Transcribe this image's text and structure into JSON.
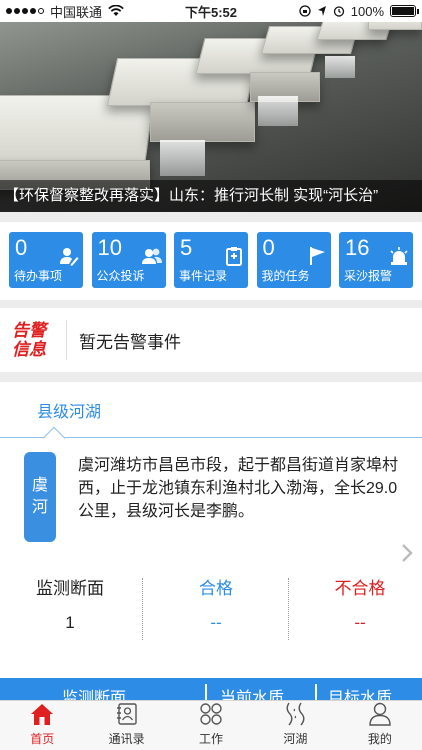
{
  "status_bar": {
    "carrier": "中国联通",
    "time": "下午5:52",
    "battery": "100%",
    "battery_level": 1.0
  },
  "banner": {
    "caption": "【环保督察整改再落实】山东：推行河长制 实现“河长治”"
  },
  "tiles": [
    {
      "count": "0",
      "label": "待办事项",
      "icon": "edit-person-icon"
    },
    {
      "count": "10",
      "label": "公众投诉",
      "icon": "group-icon"
    },
    {
      "count": "5",
      "label": "事件记录",
      "icon": "clipboard-icon"
    },
    {
      "count": "0",
      "label": "我的任务",
      "icon": "flag-icon"
    },
    {
      "count": "16",
      "label": "采沙报警",
      "icon": "alarm-light-icon"
    }
  ],
  "alert": {
    "tag_line1": "告警",
    "tag_line2": "信息",
    "message": "暂无告警事件"
  },
  "lake": {
    "tab": "县级河湖",
    "badge_line1": "虞",
    "badge_line2": "河",
    "description": "虞河潍坊市昌邑市段，起于都昌街道肖家埠村西，止于龙池镇东利渔村北入渤海，全长29.0公里，县级河长是李鹏。",
    "columns": [
      {
        "header": "监测断面",
        "value": "1",
        "color": "#222222"
      },
      {
        "header": "合格",
        "value": "--",
        "color": "#2d8de6"
      },
      {
        "header": "不合格",
        "value": "--",
        "color": "#e02020"
      }
    ],
    "bar": [
      "监测断面",
      "当前水质",
      "目标水质"
    ]
  },
  "nav": [
    {
      "label": "首页",
      "icon": "home-icon",
      "active": true
    },
    {
      "label": "通讯录",
      "icon": "contacts-icon",
      "active": false
    },
    {
      "label": "工作",
      "icon": "grid-icon",
      "active": false
    },
    {
      "label": "河湖",
      "icon": "river-icon",
      "active": false
    },
    {
      "label": "我的",
      "icon": "person-icon",
      "active": false
    }
  ],
  "colors": {
    "accent": "#2d8de6",
    "alert": "#e02020"
  }
}
